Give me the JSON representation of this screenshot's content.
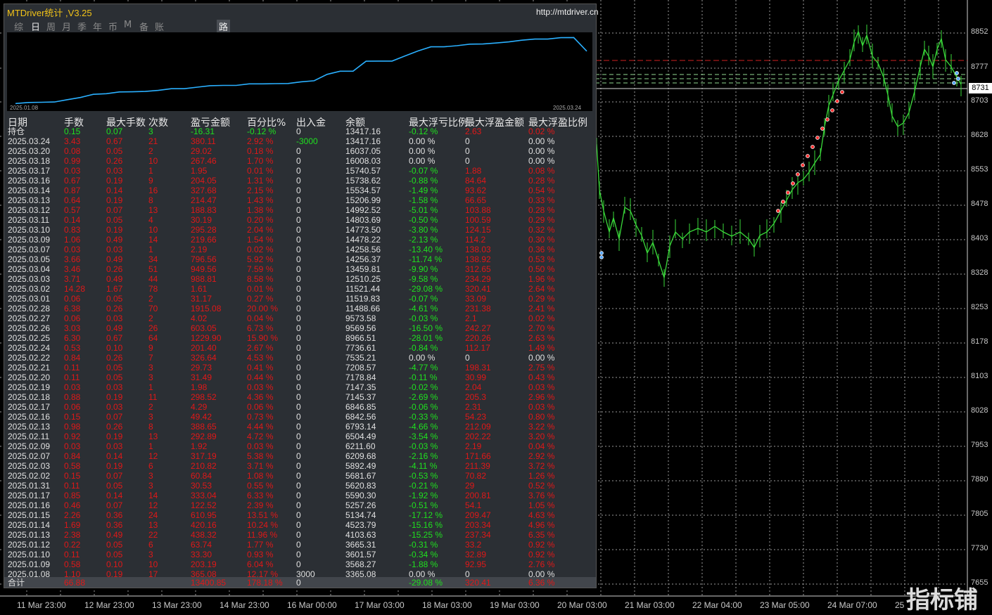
{
  "window": {
    "title": "MTDriver统计 ,V3.25",
    "url": "http://mtdriver.cn"
  },
  "tabs": [
    {
      "label": "综"
    },
    {
      "label": "日"
    },
    {
      "label": "周"
    },
    {
      "label": "月"
    },
    {
      "label": "季"
    },
    {
      "label": "年"
    },
    {
      "label": "币"
    },
    {
      "label": "M"
    },
    {
      "label": "备"
    },
    {
      "label": "账户"
    },
    {
      "label": "路径"
    }
  ],
  "equity_chart": {
    "start_date": "2025.01.08",
    "end_date": "2025.03.24",
    "line_color": "#2ab0ff",
    "values": [
      3365.08,
      3568.27,
      3601.57,
      3665.31,
      4103.63,
      4523.79,
      5134.74,
      5257.26,
      5590.3,
      5620.83,
      5681.67,
      5892.49,
      6209.68,
      6211.6,
      6504.49,
      6793.14,
      6842.56,
      6846.85,
      7145.37,
      7147.35,
      7178.84,
      7208.57,
      7535.21,
      7736.61,
      8966.51,
      9569.56,
      9573.58,
      11488.66,
      11519.83,
      11521.44,
      12510.25,
      13459.81,
      14256.37,
      14258.56,
      14478.22,
      14773.5,
      14803.69,
      14992.52,
      15206.99,
      15534.57,
      15738.62,
      15740.57,
      16008.03,
      16037.05,
      13417.16
    ]
  },
  "table": {
    "headers": [
      "日期",
      "手数",
      "最大手数",
      "次数",
      "盈亏金额",
      "百分比%",
      "出入金",
      "余额",
      "最大浮亏比例",
      "最大浮盈金额",
      "最大浮盈比例"
    ],
    "holding": {
      "label": "持仓",
      "lots": "0.15",
      "max_lots": "0.07",
      "count": "3",
      "pnl": "-16.31",
      "pct": "-0.12 %",
      "io": "0",
      "balance": "13417.16",
      "max_dd": "-0.12 %",
      "max_fp": "2.63",
      "max_fp_pct": "0.02 %"
    },
    "rows": [
      {
        "date": "2025.03.24",
        "lots": "3.43",
        "max_lots": "0.67",
        "count": "21",
        "pnl": "380.11",
        "pct": "2.92 %",
        "io": "-3000",
        "balance": "13417.16",
        "max_dd": "0.00 %",
        "max_fp": "0",
        "max_fp_pct": "0.00 %"
      },
      {
        "date": "2025.03.20",
        "lots": "0.08",
        "max_lots": "0.05",
        "count": "2",
        "pnl": "29.02",
        "pct": "0.18 %",
        "io": "0",
        "balance": "16037.05",
        "max_dd": "0.00 %",
        "max_fp": "0",
        "max_fp_pct": "0.00 %"
      },
      {
        "date": "2025.03.18",
        "lots": "0.99",
        "max_lots": "0.26",
        "count": "10",
        "pnl": "267.46",
        "pct": "1.70 %",
        "io": "0",
        "balance": "16008.03",
        "max_dd": "0.00 %",
        "max_fp": "0",
        "max_fp_pct": "0.00 %"
      },
      {
        "date": "2025.03.17",
        "lots": "0.03",
        "max_lots": "0.03",
        "count": "1",
        "pnl": "1.95",
        "pct": "0.01 %",
        "io": "0",
        "balance": "15740.57",
        "max_dd": "-0.07 %",
        "max_fp": "1.88",
        "max_fp_pct": "0.08 %"
      },
      {
        "date": "2025.03.16",
        "lots": "0.67",
        "max_lots": "0.19",
        "count": "9",
        "pnl": "204.05",
        "pct": "1.31 %",
        "io": "0",
        "balance": "15738.62",
        "max_dd": "-0.88 %",
        "max_fp": "84.64",
        "max_fp_pct": "0.28 %"
      },
      {
        "date": "2025.03.14",
        "lots": "0.87",
        "max_lots": "0.14",
        "count": "16",
        "pnl": "327.68",
        "pct": "2.15 %",
        "io": "0",
        "balance": "15534.57",
        "max_dd": "-1.49 %",
        "max_fp": "93.62",
        "max_fp_pct": "0.54 %"
      },
      {
        "date": "2025.03.13",
        "lots": "0.64",
        "max_lots": "0.19",
        "count": "8",
        "pnl": "214.47",
        "pct": "1.43 %",
        "io": "0",
        "balance": "15206.99",
        "max_dd": "-1.58 %",
        "max_fp": "66.65",
        "max_fp_pct": "0.33 %"
      },
      {
        "date": "2025.03.12",
        "lots": "0.57",
        "max_lots": "0.07",
        "count": "13",
        "pnl": "188.83",
        "pct": "1.38 %",
        "io": "0",
        "balance": "14992.52",
        "max_dd": "-5.01 %",
        "max_fp": "103.88",
        "max_fp_pct": "0.28 %"
      },
      {
        "date": "2025.03.11",
        "lots": "0.14",
        "max_lots": "0.05",
        "count": "4",
        "pnl": "30.19",
        "pct": "0.20 %",
        "io": "0",
        "balance": "14803.69",
        "max_dd": "-0.50 %",
        "max_fp": "100.59",
        "max_fp_pct": "0.29 %"
      },
      {
        "date": "2025.03.10",
        "lots": "0.83",
        "max_lots": "0.19",
        "count": "10",
        "pnl": "295.28",
        "pct": "2.04 %",
        "io": "0",
        "balance": "14773.50",
        "max_dd": "-3.80 %",
        "max_fp": "124.15",
        "max_fp_pct": "0.32 %"
      },
      {
        "date": "2025.03.09",
        "lots": "1.06",
        "max_lots": "0.49",
        "count": "14",
        "pnl": "219.66",
        "pct": "1.54 %",
        "io": "0",
        "balance": "14478.22",
        "max_dd": "-2.13 %",
        "max_fp": "114.2",
        "max_fp_pct": "0.30 %"
      },
      {
        "date": "2025.03.07",
        "lots": "0.03",
        "max_lots": "0.03",
        "count": "1",
        "pnl": "2.19",
        "pct": "0.02 %",
        "io": "0",
        "balance": "14258.56",
        "max_dd": "-13.40 %",
        "max_fp": "138.03",
        "max_fp_pct": "0.36 %"
      },
      {
        "date": "2025.03.05",
        "lots": "3.66",
        "max_lots": "0.49",
        "count": "34",
        "pnl": "796.56",
        "pct": "5.92 %",
        "io": "0",
        "balance": "14256.37",
        "max_dd": "-11.74 %",
        "max_fp": "138.92",
        "max_fp_pct": "0.53 %"
      },
      {
        "date": "2025.03.04",
        "lots": "3.46",
        "max_lots": "0.26",
        "count": "51",
        "pnl": "949.56",
        "pct": "7.59 %",
        "io": "0",
        "balance": "13459.81",
        "max_dd": "-9.90 %",
        "max_fp": "312.65",
        "max_fp_pct": "0.50 %"
      },
      {
        "date": "2025.03.03",
        "lots": "3.71",
        "max_lots": "0.49",
        "count": "44",
        "pnl": "988.81",
        "pct": "8.58 %",
        "io": "0",
        "balance": "12510.25",
        "max_dd": "-9.58 %",
        "max_fp": "234.29",
        "max_fp_pct": "1.96 %"
      },
      {
        "date": "2025.03.02",
        "lots": "14.28",
        "max_lots": "1.67",
        "count": "78",
        "pnl": "1.61",
        "pct": "0.01 %",
        "io": "0",
        "balance": "11521.44",
        "max_dd": "-29.08 %",
        "max_fp": "320.41",
        "max_fp_pct": "2.64 %"
      },
      {
        "date": "2025.03.01",
        "lots": "0.06",
        "max_lots": "0.05",
        "count": "2",
        "pnl": "31.17",
        "pct": "0.27 %",
        "io": "0",
        "balance": "11519.83",
        "max_dd": "-0.07 %",
        "max_fp": "33.09",
        "max_fp_pct": "0.29 %"
      },
      {
        "date": "2025.02.28",
        "lots": "6.38",
        "max_lots": "0.26",
        "count": "70",
        "pnl": "1915.08",
        "pct": "20.00 %",
        "io": "0",
        "balance": "11488.66",
        "max_dd": "-4.61 %",
        "max_fp": "231.38",
        "max_fp_pct": "2.41 %"
      },
      {
        "date": "2025.02.27",
        "lots": "0.06",
        "max_lots": "0.03",
        "count": "2",
        "pnl": "4.02",
        "pct": "0.04 %",
        "io": "0",
        "balance": "9573.58",
        "max_dd": "-0.03 %",
        "max_fp": "2.1",
        "max_fp_pct": "0.02 %"
      },
      {
        "date": "2025.02.26",
        "lots": "3.03",
        "max_lots": "0.49",
        "count": "26",
        "pnl": "603.05",
        "pct": "6.73 %",
        "io": "0",
        "balance": "9569.56",
        "max_dd": "-16.50 %",
        "max_fp": "242.27",
        "max_fp_pct": "2.70 %"
      },
      {
        "date": "2025.02.25",
        "lots": "6.30",
        "max_lots": "0.67",
        "count": "64",
        "pnl": "1229.90",
        "pct": "15.90 %",
        "io": "0",
        "balance": "8966.51",
        "max_dd": "-28.01 %",
        "max_fp": "220.26",
        "max_fp_pct": "2.63 %"
      },
      {
        "date": "2025.02.24",
        "lots": "0.53",
        "max_lots": "0.10",
        "count": "9",
        "pnl": "201.40",
        "pct": "2.67 %",
        "io": "0",
        "balance": "7736.61",
        "max_dd": "-0.84 %",
        "max_fp": "112.17",
        "max_fp_pct": "1.49 %"
      },
      {
        "date": "2025.02.22",
        "lots": "0.84",
        "max_lots": "0.26",
        "count": "7",
        "pnl": "326.64",
        "pct": "4.53 %",
        "io": "0",
        "balance": "7535.21",
        "max_dd": "0.00 %",
        "max_fp": "0",
        "max_fp_pct": "0.00 %"
      },
      {
        "date": "2025.02.21",
        "lots": "0.11",
        "max_lots": "0.05",
        "count": "3",
        "pnl": "29.73",
        "pct": "0.41 %",
        "io": "0",
        "balance": "7208.57",
        "max_dd": "-4.77 %",
        "max_fp": "198.31",
        "max_fp_pct": "2.75 %"
      },
      {
        "date": "2025.02.20",
        "lots": "0.11",
        "max_lots": "0.05",
        "count": "3",
        "pnl": "31.49",
        "pct": "0.44 %",
        "io": "0",
        "balance": "7178.84",
        "max_dd": "-0.11 %",
        "max_fp": "30.99",
        "max_fp_pct": "0.43 %"
      },
      {
        "date": "2025.02.19",
        "lots": "0.03",
        "max_lots": "0.03",
        "count": "1",
        "pnl": "1.98",
        "pct": "0.03 %",
        "io": "0",
        "balance": "7147.35",
        "max_dd": "-0.02 %",
        "max_fp": "2.04",
        "max_fp_pct": "0.03 %"
      },
      {
        "date": "2025.02.18",
        "lots": "0.88",
        "max_lots": "0.19",
        "count": "11",
        "pnl": "298.52",
        "pct": "4.36 %",
        "io": "0",
        "balance": "7145.37",
        "max_dd": "-2.69 %",
        "max_fp": "205.3",
        "max_fp_pct": "2.96 %"
      },
      {
        "date": "2025.02.17",
        "lots": "0.06",
        "max_lots": "0.03",
        "count": "2",
        "pnl": "4.29",
        "pct": "0.06 %",
        "io": "0",
        "balance": "6846.85",
        "max_dd": "-0.06 %",
        "max_fp": "2.31",
        "max_fp_pct": "0.03 %"
      },
      {
        "date": "2025.02.16",
        "lots": "0.15",
        "max_lots": "0.07",
        "count": "3",
        "pnl": "49.42",
        "pct": "0.73 %",
        "io": "0",
        "balance": "6842.56",
        "max_dd": "-0.33 %",
        "max_fp": "54.23",
        "max_fp_pct": "0.80 %"
      },
      {
        "date": "2025.02.13",
        "lots": "0.98",
        "max_lots": "0.26",
        "count": "8",
        "pnl": "388.65",
        "pct": "4.44 %",
        "io": "0",
        "balance": "6793.14",
        "max_dd": "-4.66 %",
        "max_fp": "212.09",
        "max_fp_pct": "3.22 %"
      },
      {
        "date": "2025.02.11",
        "lots": "0.92",
        "max_lots": "0.19",
        "count": "13",
        "pnl": "292.89",
        "pct": "4.72 %",
        "io": "0",
        "balance": "6504.49",
        "max_dd": "-3.54 %",
        "max_fp": "202.22",
        "max_fp_pct": "3.20 %"
      },
      {
        "date": "2025.02.09",
        "lots": "0.03",
        "max_lots": "0.03",
        "count": "1",
        "pnl": "1.92",
        "pct": "0.03 %",
        "io": "0",
        "balance": "6211.60",
        "max_dd": "-0.03 %",
        "max_fp": "2.19",
        "max_fp_pct": "0.04 %"
      },
      {
        "date": "2025.02.07",
        "lots": "0.84",
        "max_lots": "0.14",
        "count": "12",
        "pnl": "317.19",
        "pct": "5.38 %",
        "io": "0",
        "balance": "6209.68",
        "max_dd": "-2.16 %",
        "max_fp": "171.66",
        "max_fp_pct": "2.92 %"
      },
      {
        "date": "2025.02.03",
        "lots": "0.58",
        "max_lots": "0.19",
        "count": "6",
        "pnl": "210.82",
        "pct": "3.71 %",
        "io": "0",
        "balance": "5892.49",
        "max_dd": "-4.11 %",
        "max_fp": "211.39",
        "max_fp_pct": "3.72 %"
      },
      {
        "date": "2025.02.02",
        "lots": "0.15",
        "max_lots": "0.07",
        "count": "3",
        "pnl": "60.84",
        "pct": "1.08 %",
        "io": "0",
        "balance": "5681.67",
        "max_dd": "-0.53 %",
        "max_fp": "70.82",
        "max_fp_pct": "1.26 %"
      },
      {
        "date": "2025.01.31",
        "lots": "0.11",
        "max_lots": "0.05",
        "count": "3",
        "pnl": "30.53",
        "pct": "0.55 %",
        "io": "0",
        "balance": "5620.83",
        "max_dd": "-0.21 %",
        "max_fp": "29",
        "max_fp_pct": "0.52 %"
      },
      {
        "date": "2025.01.17",
        "lots": "0.85",
        "max_lots": "0.14",
        "count": "14",
        "pnl": "333.04",
        "pct": "6.33 %",
        "io": "0",
        "balance": "5590.30",
        "max_dd": "-1.92 %",
        "max_fp": "200.81",
        "max_fp_pct": "3.76 %"
      },
      {
        "date": "2025.01.16",
        "lots": "0.46",
        "max_lots": "0.07",
        "count": "12",
        "pnl": "122.52",
        "pct": "2.39 %",
        "io": "0",
        "balance": "5257.26",
        "max_dd": "-0.51 %",
        "max_fp": "54.1",
        "max_fp_pct": "1.05 %"
      },
      {
        "date": "2025.01.15",
        "lots": "2.26",
        "max_lots": "0.36",
        "count": "24",
        "pnl": "610.95",
        "pct": "13.51 %",
        "io": "0",
        "balance": "5134.74",
        "max_dd": "-17.12 %",
        "max_fp": "209.47",
        "max_fp_pct": "4.63 %"
      },
      {
        "date": "2025.01.14",
        "lots": "1.69",
        "max_lots": "0.36",
        "count": "13",
        "pnl": "420.16",
        "pct": "10.24 %",
        "io": "0",
        "balance": "4523.79",
        "max_dd": "-15.16 %",
        "max_fp": "203.34",
        "max_fp_pct": "4.96 %"
      },
      {
        "date": "2025.01.13",
        "lots": "2.38",
        "max_lots": "0.49",
        "count": "22",
        "pnl": "438.32",
        "pct": "11.96 %",
        "io": "0",
        "balance": "4103.63",
        "max_dd": "-15.25 %",
        "max_fp": "237.34",
        "max_fp_pct": "6.35 %"
      },
      {
        "date": "2025.01.12",
        "lots": "0.22",
        "max_lots": "0.05",
        "count": "6",
        "pnl": "63.74",
        "pct": "1.77 %",
        "io": "0",
        "balance": "3665.31",
        "max_dd": "-0.31 %",
        "max_fp": "33.2",
        "max_fp_pct": "0.92 %"
      },
      {
        "date": "2025.01.10",
        "lots": "0.11",
        "max_lots": "0.05",
        "count": "3",
        "pnl": "33.30",
        "pct": "0.93 %",
        "io": "0",
        "balance": "3601.57",
        "max_dd": "-0.34 %",
        "max_fp": "32.89",
        "max_fp_pct": "0.92 %"
      },
      {
        "date": "2025.01.09",
        "lots": "0.58",
        "max_lots": "0.10",
        "count": "10",
        "pnl": "203.19",
        "pct": "6.04 %",
        "io": "0",
        "balance": "3568.27",
        "max_dd": "-1.88 %",
        "max_fp": "92.95",
        "max_fp_pct": "2.76 %"
      },
      {
        "date": "2025.01.08",
        "lots": "1.10",
        "max_lots": "0.19",
        "count": "17",
        "pnl": "365.08",
        "pct": "12.17 %",
        "io": "3000",
        "balance": "3365.08",
        "max_dd": "0.00 %",
        "max_fp": "0",
        "max_fp_pct": "0.00 %"
      }
    ],
    "total": {
      "label": "合计",
      "lots": "66.88",
      "pnl": "13400.85",
      "pct": "178.18 %",
      "io": "0",
      "max_dd": "-29.08 %",
      "max_fp": "320.41",
      "max_fp_pct": "6.36 %"
    }
  },
  "price_axis": [
    "8852",
    "8777",
    "8703",
    "8628",
    "8553",
    "8478",
    "8403",
    "8328",
    "8253",
    "8178",
    "8103",
    "8028",
    "7953",
    "7880",
    "7805",
    "7730",
    "7655"
  ],
  "current_price": "8731",
  "time_axis": [
    "11 Mar 23:00",
    "12 Mar 23:00",
    "13 Mar 23:00",
    "14 Mar 23:00",
    "16 Mar 00:00",
    "17 Mar 03:00",
    "18 Mar 03:00",
    "19 Mar 03:00",
    "20 Mar 03:00",
    "21 Mar 03:00",
    "22 Mar 04:00",
    "23 Mar 05:00",
    "24 Mar 07:00",
    "25"
  ],
  "watermark": "指标铺",
  "colors": {
    "panel_bg": "#2b2f34",
    "loss": "#e01818",
    "gain": "#1fe01f",
    "title": "#f2c318",
    "candles": "#3ad93a",
    "grid": "#9a9a9a"
  }
}
